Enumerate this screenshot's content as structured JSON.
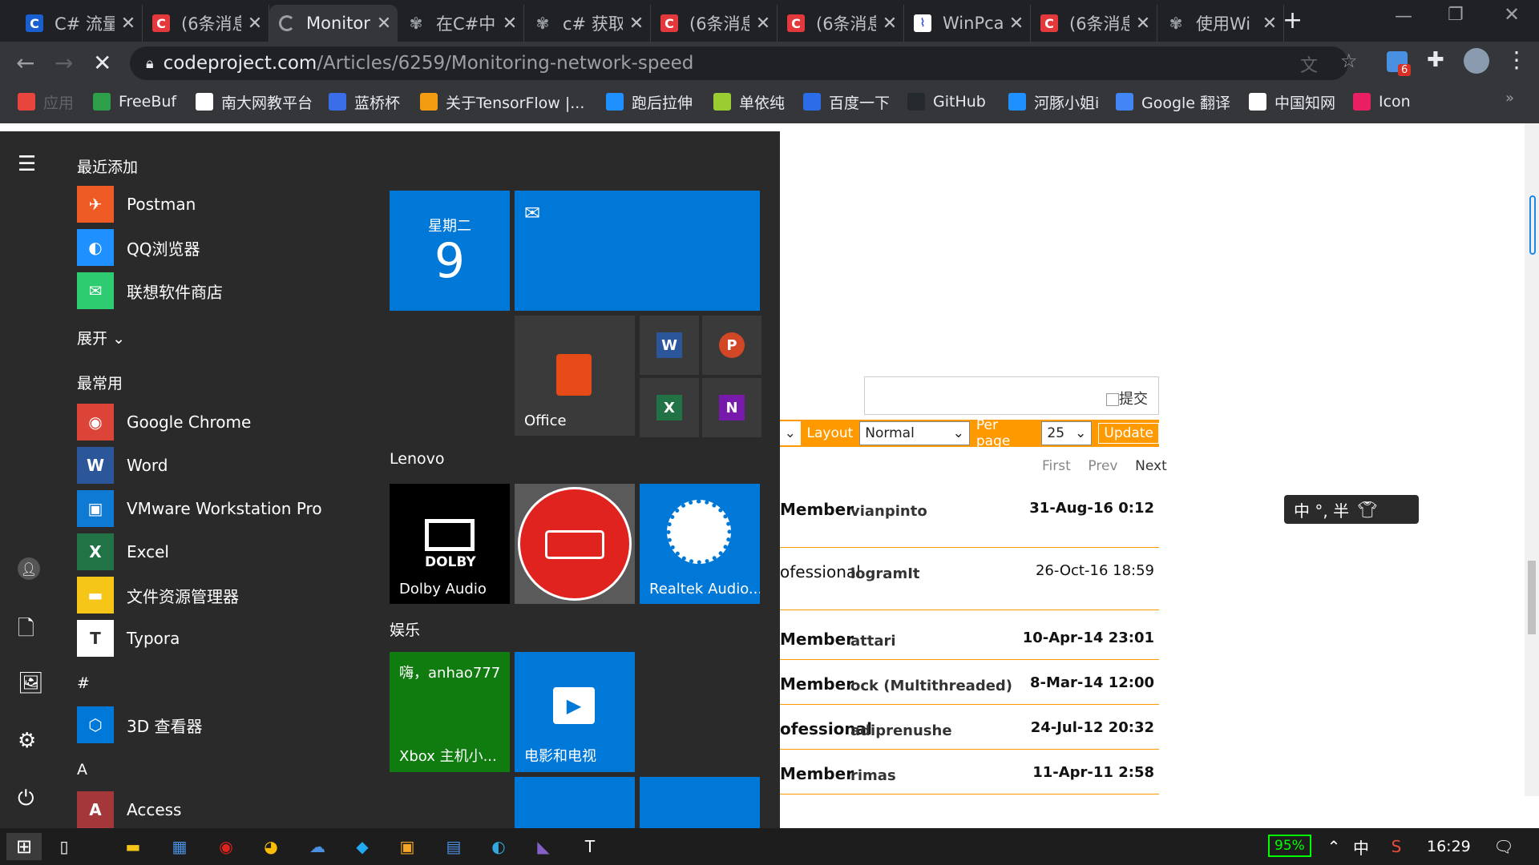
{
  "browser": {
    "tabs": [
      {
        "title": "C# 流量",
        "icon": "baidu-paw-icon",
        "icon_class": "blue",
        "glyph": "C"
      },
      {
        "title": "(6条消息",
        "icon": "csdn-icon",
        "icon_class": "c",
        "glyph": "C"
      },
      {
        "title": "Monitor",
        "icon": "loading-icon",
        "icon_class": "load",
        "glyph": "",
        "active": true
      },
      {
        "title": "在C#中",
        "icon": "baidu-paw-icon",
        "icon_class": "paw",
        "glyph": "✾"
      },
      {
        "title": "c# 获取",
        "icon": "baidu-paw-icon",
        "icon_class": "paw",
        "glyph": "✾"
      },
      {
        "title": "(6条消息",
        "icon": "csdn-icon",
        "icon_class": "c",
        "glyph": "C"
      },
      {
        "title": "(6条消息",
        "icon": "csdn-icon",
        "icon_class": "c",
        "glyph": "C"
      },
      {
        "title": "WinPca",
        "icon": "wave-icon",
        "icon_class": "wave",
        "glyph": "⌇"
      },
      {
        "title": "(6条消息",
        "icon": "csdn-icon",
        "icon_class": "c",
        "glyph": "C"
      },
      {
        "title": "使用Wi",
        "icon": "baidu-paw-icon",
        "icon_class": "paw",
        "glyph": "✾"
      }
    ],
    "url_host": "codeproject.com",
    "url_path": "/Articles/6259/Monitoring-network-speed",
    "extension_badge": "6",
    "bookmarks": [
      {
        "label": "应用",
        "color": "#e8453c"
      },
      {
        "label": "FreeBuf",
        "color": "#2e9f49"
      },
      {
        "label": "南大网教平台",
        "color": "#ffffff"
      },
      {
        "label": "蓝桥杯",
        "color": "#3a6ee8"
      },
      {
        "label": "关于TensorFlow |...",
        "color": "#f39c12"
      },
      {
        "label": "跑后拉伸",
        "color": "#1e90ff"
      },
      {
        "label": "单依纯",
        "color": "#9acd32"
      },
      {
        "label": "百度一下",
        "color": "#2b6de6"
      },
      {
        "label": "GitHub",
        "color": "#24292e"
      },
      {
        "label": "河豚小姐i",
        "color": "#1e90ff"
      },
      {
        "label": "Google 翻译",
        "color": "#4285f4"
      },
      {
        "label": "中国知网",
        "color": "#ffffff"
      },
      {
        "label": "Icon",
        "color": "#e91e63"
      }
    ]
  },
  "webpage": {
    "submit_alt": "提交",
    "layout_label": "Layout",
    "layout_value": "Normal",
    "perpage_label": "Per page",
    "perpage_value": "25",
    "update_label": "Update",
    "pager": {
      "first": "First",
      "prev": "Prev",
      "next": "Next"
    },
    "rows": [
      {
        "type": "Member",
        "name": "vianpinto",
        "date": "31-Aug-16 0:12",
        "bold": true
      },
      {
        "type": "ofessional",
        "name": "logramIt",
        "date": "26-Oct-16 18:59",
        "bold": false
      },
      {
        "type": "Member",
        "name": "attari",
        "date": "10-Apr-14 23:01",
        "bold": true
      },
      {
        "type": "Member",
        "name": "ock (Multithreaded)",
        "date": "8-Mar-14 12:00",
        "bold": true
      },
      {
        "type": "ofessional",
        "name": "adiprenushe",
        "date": "24-Jul-12 20:32",
        "bold": true
      },
      {
        "type": "Member",
        "name": "rimas",
        "date": "11-Apr-11 2:58",
        "bold": true
      }
    ],
    "ime_bar": "中 °, 半"
  },
  "start_menu": {
    "recent_header": "最近添加",
    "recent": [
      {
        "label": "Postman",
        "color": "#ef5b25",
        "glyph": "✈"
      },
      {
        "label": "QQ浏览器",
        "color": "#1e90ff",
        "glyph": "◐"
      },
      {
        "label": "联想软件商店",
        "color": "#2ecc71",
        "glyph": "✉"
      }
    ],
    "expand_label": "展开",
    "most_used_header": "最常用",
    "most_used": [
      {
        "label": "Google Chrome",
        "color": "#db4437",
        "glyph": "◉"
      },
      {
        "label": "Word",
        "color": "#2b579a",
        "glyph": "W"
      },
      {
        "label": "VMware Workstation Pro",
        "color": "#0f7ad4",
        "glyph": "▣"
      },
      {
        "label": "Excel",
        "color": "#217346",
        "glyph": "X"
      },
      {
        "label": "文件资源管理器",
        "color": "#f5c518",
        "glyph": "▬"
      },
      {
        "label": "Typora",
        "color": "#ffffff",
        "glyph": "T"
      }
    ],
    "hash_header": "#",
    "hash_apps": [
      {
        "label": "3D 查看器",
        "color": "#0078d7",
        "glyph": "⬡"
      }
    ],
    "a_header": "A",
    "a_apps": [
      {
        "label": "Access",
        "color": "#a4373a",
        "glyph": "A"
      }
    ],
    "tiles": {
      "calendar_day": "星期二",
      "calendar_date": "9",
      "office_label": "Office",
      "lenovo_group": "Lenovo",
      "dolby_label": "Dolby Audio",
      "dolby_logo": "DOLBY",
      "realtek_label": "Realtek Audio...",
      "ent_group": "娱乐",
      "xbox_greeting": "嗨，anhao777",
      "xbox_label": "Xbox 主机小...",
      "movies_label": "电影和电视",
      "word_glyph": "W",
      "ppt_glyph": "P",
      "excel_glyph": "X",
      "onenote_glyph": "N"
    }
  },
  "taskbar": {
    "battery": "95%",
    "ime": "中",
    "time": "16:29"
  }
}
